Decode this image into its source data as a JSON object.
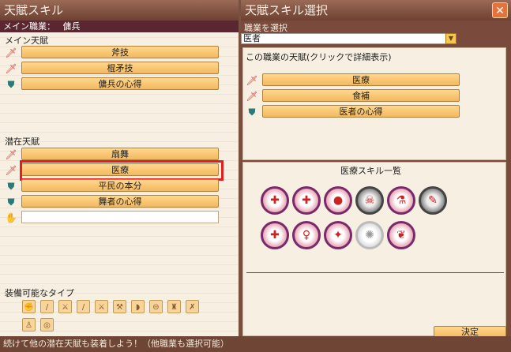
{
  "left": {
    "title": "天賦スキル",
    "job_label": "メイン職業：",
    "job_value": "傭兵",
    "main_section": "メイン天賦",
    "main_items": [
      {
        "label": "斧技",
        "icon": "sword-icon"
      },
      {
        "label": "棍矛技",
        "icon": "sword-icon"
      },
      {
        "label": "傭兵の心得",
        "icon": "shield-icon"
      }
    ],
    "latent_section": "潜在天賦",
    "latent_items": [
      {
        "label": "扇舞",
        "icon": "sword-icon"
      },
      {
        "label": "医療",
        "icon": "sword-icon",
        "highlighted": true
      },
      {
        "label": "平民の本分",
        "icon": "shield-icon"
      },
      {
        "label": "舞者の心得",
        "icon": "shield-icon"
      },
      {
        "label": "",
        "icon": "hand-icon"
      }
    ],
    "equip_section": "装備可能なタイプ"
  },
  "right": {
    "title": "天賦スキル選択",
    "job_select_label": "職業を選択",
    "job_selected": "医者",
    "talent_header": "この職業の天賦(クリックで詳細表示)",
    "talent_items": [
      {
        "label": "医療",
        "icon": "sword-icon"
      },
      {
        "label": "食補",
        "icon": "sword-icon"
      },
      {
        "label": "医者の心得",
        "icon": "shield-icon"
      }
    ],
    "skill_list_title": "医療スキル一覧",
    "confirm_label": "決定"
  },
  "footer": {
    "text": "続けて他の潜在天賦も装着しよう！（他職業も選択可能）"
  },
  "icons": {
    "close": "✕"
  }
}
